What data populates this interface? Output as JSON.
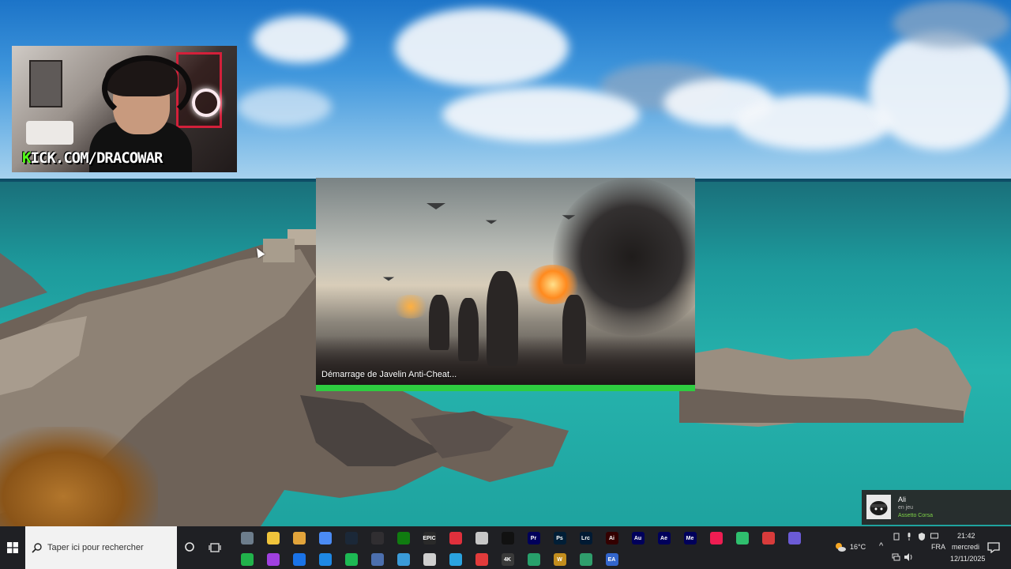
{
  "webcam": {
    "label_k": "K",
    "label_rest": "ICK.COM/DRACOWAR"
  },
  "splash": {
    "status": "Démarrage de Javelin Anti-Cheat...",
    "progress": 1.0,
    "progress_color": "#2ecc40"
  },
  "toast": {
    "name": "Ali",
    "status": "en jeu",
    "game": "Assetto Corsa"
  },
  "taskbar": {
    "search_placeholder": "Taper ici pour rechercher",
    "row1_icons": [
      {
        "name": "file-server-icon",
        "color": "#6d7d8c",
        "text": ""
      },
      {
        "name": "file-explorer-icon",
        "color": "#f0c43b",
        "text": ""
      },
      {
        "name": "chrome-canary-icon",
        "color": "#e2a43b",
        "text": ""
      },
      {
        "name": "chrome-icon",
        "color": "#4b8bf4",
        "text": ""
      },
      {
        "name": "steam-icon",
        "color": "#1b2838",
        "text": ""
      },
      {
        "name": "obs-icon",
        "color": "#302e31",
        "text": ""
      },
      {
        "name": "xbox-icon",
        "color": "#107c10",
        "text": ""
      },
      {
        "name": "epic-games-icon",
        "color": "#2a2a2a",
        "text": "EPIC"
      },
      {
        "name": "ea-red-icon",
        "color": "#e0303c",
        "text": ""
      },
      {
        "name": "game-controller-icon",
        "color": "#c7c7c7",
        "text": ""
      },
      {
        "name": "capcut-icon",
        "color": "#111111",
        "text": ""
      },
      {
        "name": "premiere-icon",
        "color": "#00005b",
        "text": "Pr"
      },
      {
        "name": "photoshop-icon",
        "color": "#001e36",
        "text": "Ps"
      },
      {
        "name": "lightroom-classic-icon",
        "color": "#001a33",
        "text": "Lrc"
      },
      {
        "name": "illustrator-icon",
        "color": "#330000",
        "text": "Ai"
      },
      {
        "name": "audition-icon",
        "color": "#00005b",
        "text": "Au"
      },
      {
        "name": "after-effects-icon",
        "color": "#00005b",
        "text": "Ae"
      },
      {
        "name": "media-encoder-icon",
        "color": "#00005b",
        "text": "Me"
      },
      {
        "name": "tiktok-icon",
        "color": "#ee1d52",
        "text": ""
      },
      {
        "name": "discord-bot-icon",
        "color": "#2fbf6e",
        "text": ""
      },
      {
        "name": "streamlabs-icon",
        "color": "#d83b3b",
        "text": ""
      },
      {
        "name": "diamond-app-icon",
        "color": "#6b5bd6",
        "text": ""
      }
    ],
    "row2_icons": [
      {
        "name": "sync-app-icon",
        "color": "#21b24b",
        "text": ""
      },
      {
        "name": "messenger-icon",
        "color": "#a040e0",
        "text": ""
      },
      {
        "name": "outlook-icon",
        "color": "#1a73e8",
        "text": ""
      },
      {
        "name": "bluetooth-app-icon",
        "color": "#1e88e5",
        "text": ""
      },
      {
        "name": "spotify-icon",
        "color": "#1db954",
        "text": ""
      },
      {
        "name": "phone-link-icon",
        "color": "#4c6fae",
        "text": ""
      },
      {
        "name": "capture-tool-icon",
        "color": "#3a9bd9",
        "text": ""
      },
      {
        "name": "pen-tool-icon",
        "color": "#cfcfcf",
        "text": ""
      },
      {
        "name": "telegram-icon",
        "color": "#2aa3df",
        "text": ""
      },
      {
        "name": "red-app-icon",
        "color": "#e23b3b",
        "text": ""
      },
      {
        "name": "4k-downloader-icon",
        "color": "#3a3a3a",
        "text": "4K"
      },
      {
        "name": "edge-icon",
        "color": "#27a06b",
        "text": ""
      },
      {
        "name": "warcraft-icon",
        "color": "#c28d1d",
        "text": "W"
      },
      {
        "name": "ms-store-icon",
        "color": "#2f9e6c",
        "text": ""
      },
      {
        "name": "ea-app-icon",
        "color": "#3366cc",
        "text": "EA"
      }
    ],
    "weather_temp": "16°C",
    "tray_chevron": "^",
    "language": "FRA",
    "time": "21:42",
    "day": "mercredi",
    "date": "12/11/2025"
  }
}
